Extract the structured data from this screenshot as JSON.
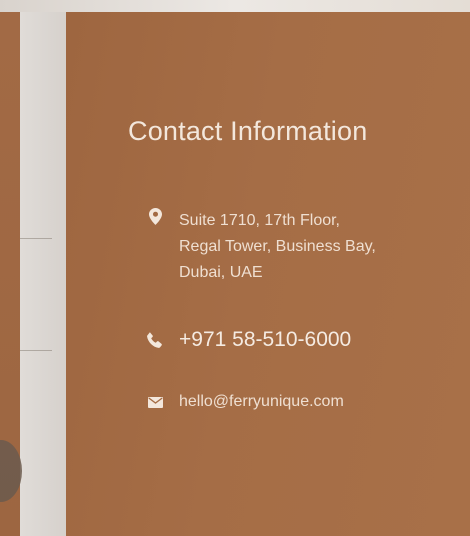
{
  "contact": {
    "title": "Contact Information",
    "address": {
      "icon": "map-pin-icon",
      "lines": [
        "Suite 1710, 17th Floor,",
        "Regal Tower, Business Bay,",
        "Dubai, UAE"
      ]
    },
    "phone": {
      "icon": "phone-icon",
      "value": "+971 58-510-6000"
    },
    "email": {
      "icon": "envelope-icon",
      "value": "hello@ferryunique.com"
    }
  },
  "colors": {
    "panel": "#a56d46",
    "text": "#f1e4d8"
  }
}
